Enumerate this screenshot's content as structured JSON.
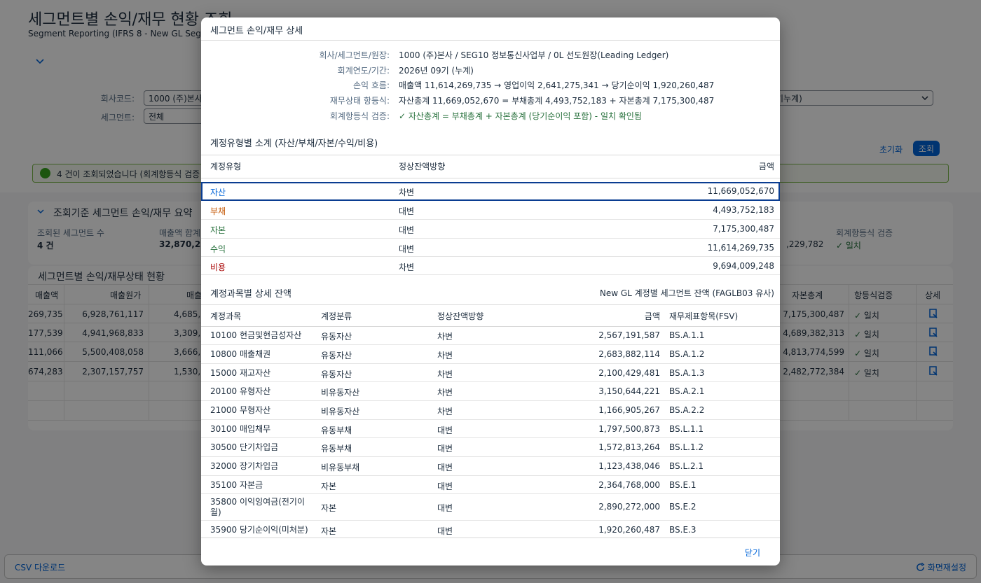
{
  "background": {
    "title": "세그먼트별 손익/재무 현황 조회",
    "subtitle": "Segment Reporting (IFRS 8 - New GL Segment",
    "filters": {
      "company_label": "회사코드:",
      "company_value": "1000 (주)본사",
      "segment_label": "세그먼트:",
      "segment_value": "전체",
      "period_value": "기누계)"
    },
    "reset_label": "초기화",
    "search_label": "조회",
    "message": "4 건이 조회되었습니다 (회계항등식 검증",
    "summary": {
      "title": "조회기준 세그먼트 손익/재무 요약",
      "kpi1_label": "조회된 세그먼트 수",
      "kpi1_value": "4 건",
      "kpi2_label": "매출액 합계",
      "kpi2_value": "32,870,232",
      "kpi3_value": ",229,782",
      "kpi4_label": "회계항등식 검증",
      "kpi4_value": "✓ 일치"
    },
    "table": {
      "title": "세그먼트별 손익/재무상태 현황",
      "columns": [
        "매출액",
        "매출원가",
        "매출",
        "자본총계",
        "항등식검증",
        "상세"
      ],
      "rows": [
        [
          "269,735",
          "6,928,761,117",
          "4,685,5",
          "7,175,300,487",
          "일치"
        ],
        [
          "177,539",
          "4,941,968,833",
          "3,309,2",
          "4,689,382,313",
          "일치"
        ],
        [
          "111,066",
          "5,500,408,058",
          "3,666,7",
          "4,813,774,599",
          "일치"
        ],
        [
          "674,283",
          "2,307,157,757",
          "1,530,5",
          "2,482,772,384",
          "일치"
        ]
      ]
    },
    "footer": {
      "csv_label": "CSV 다운로드",
      "reset_layout_label": "화면재설정"
    }
  },
  "dialog": {
    "title": "세그먼트 손익/재무 상세",
    "info": [
      {
        "label": "회사/세그먼트/원장:",
        "value": "1000 (주)본사 / SEG10 정보통신사업부 / 0L 선도원장(Leading Ledger)"
      },
      {
        "label": "회계연도/기간:",
        "value": "2026년 09기 (누계)"
      },
      {
        "label": "손익 흐름:",
        "value": "매출액 11,614,269,735 → 영업이익 2,641,275,341 → 당기순이익 1,920,260,487"
      },
      {
        "label": "재무상태 항등식:",
        "value": "자산총계 11,669,052,670 = 부채총계 4,493,752,183 + 자본총계 7,175,300,487"
      },
      {
        "label": "회계항등식 검증:",
        "value": "✓ 자산총계 = 부채총계 + 자본총계 (당기순이익 포함) - 일치 확인됨"
      }
    ],
    "summary_title": "계정유형별 소계 (자산/부채/자본/수익/비용)",
    "summary_columns": [
      "계정유형",
      "정상잔액방향",
      "금액"
    ],
    "summary_rows": [
      {
        "type": "자산",
        "dir": "차변",
        "amount": "11,669,052,670"
      },
      {
        "type": "부채",
        "dir": "대변",
        "amount": "4,493,752,183"
      },
      {
        "type": "자본",
        "dir": "대변",
        "amount": "7,175,300,487"
      },
      {
        "type": "수익",
        "dir": "대변",
        "amount": "11,614,269,735"
      },
      {
        "type": "비용",
        "dir": "차변",
        "amount": "9,694,009,248"
      }
    ],
    "detail_title": "계정과목별 상세 잔액",
    "detail_note": "New GL 계정별 세그먼트 잔액 (FAGLB03 유사)",
    "detail_columns": [
      "계정과목",
      "계정분류",
      "정상잔액방향",
      "금액",
      "재무제표항목(FSV)"
    ],
    "detail_rows": [
      {
        "acct": "10100 현금및현금성자산",
        "cls": "유동자산",
        "dir": "차변",
        "amount": "2,567,191,587",
        "fsv": "BS.A.1.1"
      },
      {
        "acct": "10800 매출채권",
        "cls": "유동자산",
        "dir": "차변",
        "amount": "2,683,882,114",
        "fsv": "BS.A.1.2"
      },
      {
        "acct": "15000 재고자산",
        "cls": "유동자산",
        "dir": "차변",
        "amount": "2,100,429,481",
        "fsv": "BS.A.1.3"
      },
      {
        "acct": "20100 유형자산",
        "cls": "비유동자산",
        "dir": "차변",
        "amount": "3,150,644,221",
        "fsv": "BS.A.2.1"
      },
      {
        "acct": "21000 무형자산",
        "cls": "비유동자산",
        "dir": "차변",
        "amount": "1,166,905,267",
        "fsv": "BS.A.2.2"
      },
      {
        "acct": "30100 매입채무",
        "cls": "유동부채",
        "dir": "대변",
        "amount": "1,797,500,873",
        "fsv": "BS.L.1.1"
      },
      {
        "acct": "30500 단기차입금",
        "cls": "유동부채",
        "dir": "대변",
        "amount": "1,572,813,264",
        "fsv": "BS.L.1.2"
      },
      {
        "acct": "32000 장기차입금",
        "cls": "비유동부채",
        "dir": "대변",
        "amount": "1,123,438,046",
        "fsv": "BS.L.2.1"
      },
      {
        "acct": "35100 자본금",
        "cls": "자본",
        "dir": "대변",
        "amount": "2,364,768,000",
        "fsv": "BS.E.1"
      },
      {
        "acct": "35800 이익잉여금(전기이월)",
        "cls": "자본",
        "dir": "대변",
        "amount": "2,890,272,000",
        "fsv": "BS.E.2"
      },
      {
        "acct": "35900 당기순이익(미처분)",
        "cls": "자본",
        "dir": "대변",
        "amount": "1,920,260,487",
        "fsv": "BS.E.3"
      }
    ],
    "close_label": "닫기"
  }
}
